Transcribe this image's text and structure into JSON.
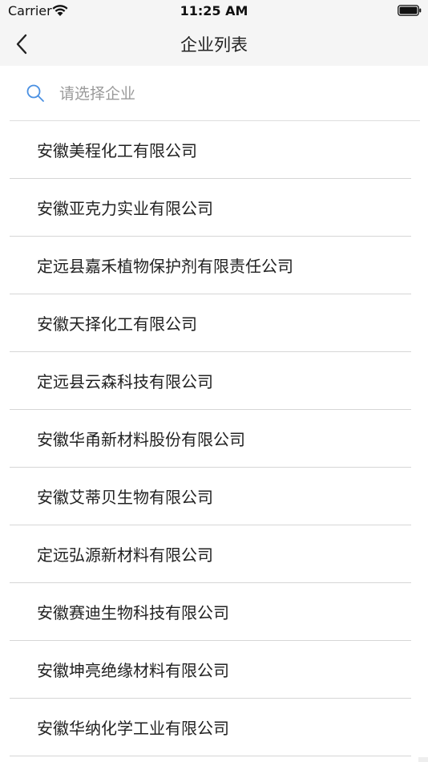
{
  "status_bar": {
    "carrier": "Carrier",
    "time": "11:25 AM"
  },
  "nav": {
    "title": "企业列表",
    "back_icon": "chevron-left-icon"
  },
  "search": {
    "placeholder": "请选择企业",
    "value": "",
    "icon": "search-icon",
    "icon_color": "#4a90e2"
  },
  "companies": [
    "安徽美程化工有限公司",
    "安徽亚克力实业有限公司",
    "定远县嘉禾植物保护剂有限责任公司",
    "安徽天择化工有限公司",
    "定远县云森科技有限公司",
    "安徽华甬新材料股份有限公司",
    "安徽艾蒂贝生物有限公司",
    "定远弘源新材料有限公司",
    "安徽赛迪生物科技有限公司",
    "安徽坤亮绝缘材料有限公司",
    "安徽华纳化学工业有限公司"
  ]
}
